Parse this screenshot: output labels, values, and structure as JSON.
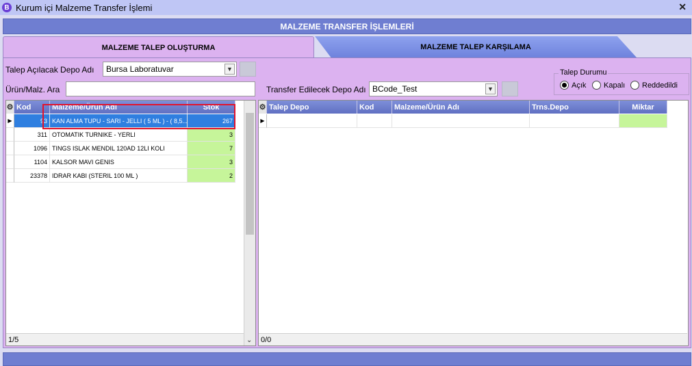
{
  "window": {
    "title": "Kurum içi Malzeme Transfer İşlemi",
    "app_icon": "B",
    "close": "✕"
  },
  "header": {
    "title": "MALZEME TRANSFER İŞLEMLERİ"
  },
  "tabs": [
    {
      "label": "MALZEME TALEP OLUŞTURMA",
      "active": true
    },
    {
      "label": "MALZEME TALEP KARŞILAMA",
      "active": false
    }
  ],
  "form": {
    "talep_depo_label": "Talep Açılacak Depo Adı",
    "talep_depo_value": "Bursa Laboratuvar",
    "search_label": "Ürün/Malz. Ara",
    "search_value": "",
    "transfer_depo_label": "Transfer Edilecek Depo Adı",
    "transfer_depo_value": "BCode_Test"
  },
  "status_group": {
    "legend": "Talep Durumu",
    "options": [
      {
        "label": "Açık",
        "checked": true
      },
      {
        "label": "Kapalı",
        "checked": false
      },
      {
        "label": "Reddedildi",
        "checked": false
      }
    ]
  },
  "left_grid": {
    "columns": [
      "Kod",
      "Malzeme/Ürün Adı",
      "Stok"
    ],
    "rows": [
      {
        "kod": "93",
        "ad": "KAN ALMA TUPU - SARI - JELLI ( 5 ML ) - ( 8,5...",
        "stok": "267",
        "selected": true
      },
      {
        "kod": "311",
        "ad": "OTOMATIK TURNIKE - YERLI",
        "stok": "3",
        "selected": false
      },
      {
        "kod": "1096",
        "ad": "TINGS ISLAK MENDIL 120AD 12LI KOLI",
        "stok": "7",
        "selected": false
      },
      {
        "kod": "1104",
        "ad": "KALSOR MAVI GENIS",
        "stok": "3",
        "selected": false
      },
      {
        "kod": "23378",
        "ad": "IDRAR KABI (STERIL 100 ML )",
        "stok": "2",
        "selected": false
      }
    ],
    "status": "1/5"
  },
  "right_grid": {
    "columns": [
      "Talep Depo",
      "Kod",
      "Malzeme/Ürün Adı",
      "Trns.Depo",
      "Miktar"
    ],
    "status": "0/0"
  },
  "colors": {
    "accent": "#6f7ed1",
    "panel": "#dcb2f0",
    "selected_row": "#2f7fe0",
    "stock_cell": "#c6f59a",
    "highlight_box": "#e3122a"
  }
}
